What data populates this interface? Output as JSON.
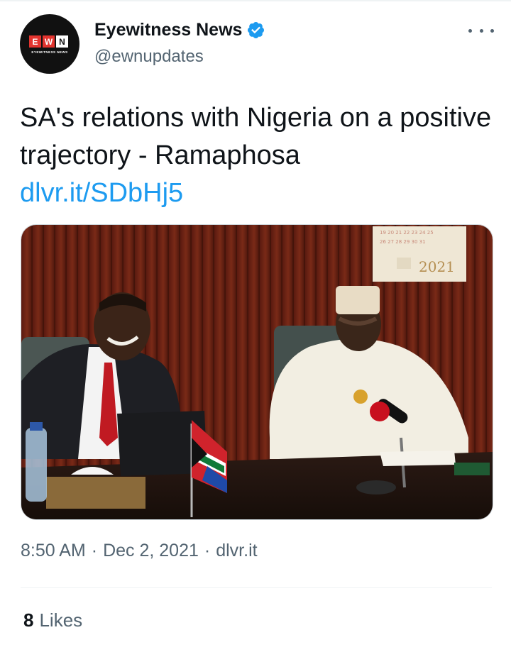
{
  "header": {
    "avatar": {
      "logo_letters": [
        "E",
        "W",
        "N"
      ],
      "logo_subtitle": "EYEWITNESS NEWS"
    },
    "display_name": "Eyewitness News",
    "handle": "@ewnupdates",
    "verified_icon": "verified-badge-icon",
    "more_icon": "more-horizontal-icon"
  },
  "tweet": {
    "text": "SA's relations with Nigeria on a positive trajectory - Ramaphosa",
    "link": "dlvr.it/SDbHj5",
    "media": {
      "calendar_year": "2021"
    }
  },
  "meta": {
    "time": "8:50 AM",
    "separator": "·",
    "date": "Dec 2, 2021",
    "source": "dlvr.it"
  },
  "stats": {
    "likes_count": "8",
    "likes_label": "Likes"
  },
  "colors": {
    "link": "#1d9bf0",
    "secondary_text": "#536471",
    "primary_text": "#0f1419",
    "verified": "#1d9bf0"
  }
}
